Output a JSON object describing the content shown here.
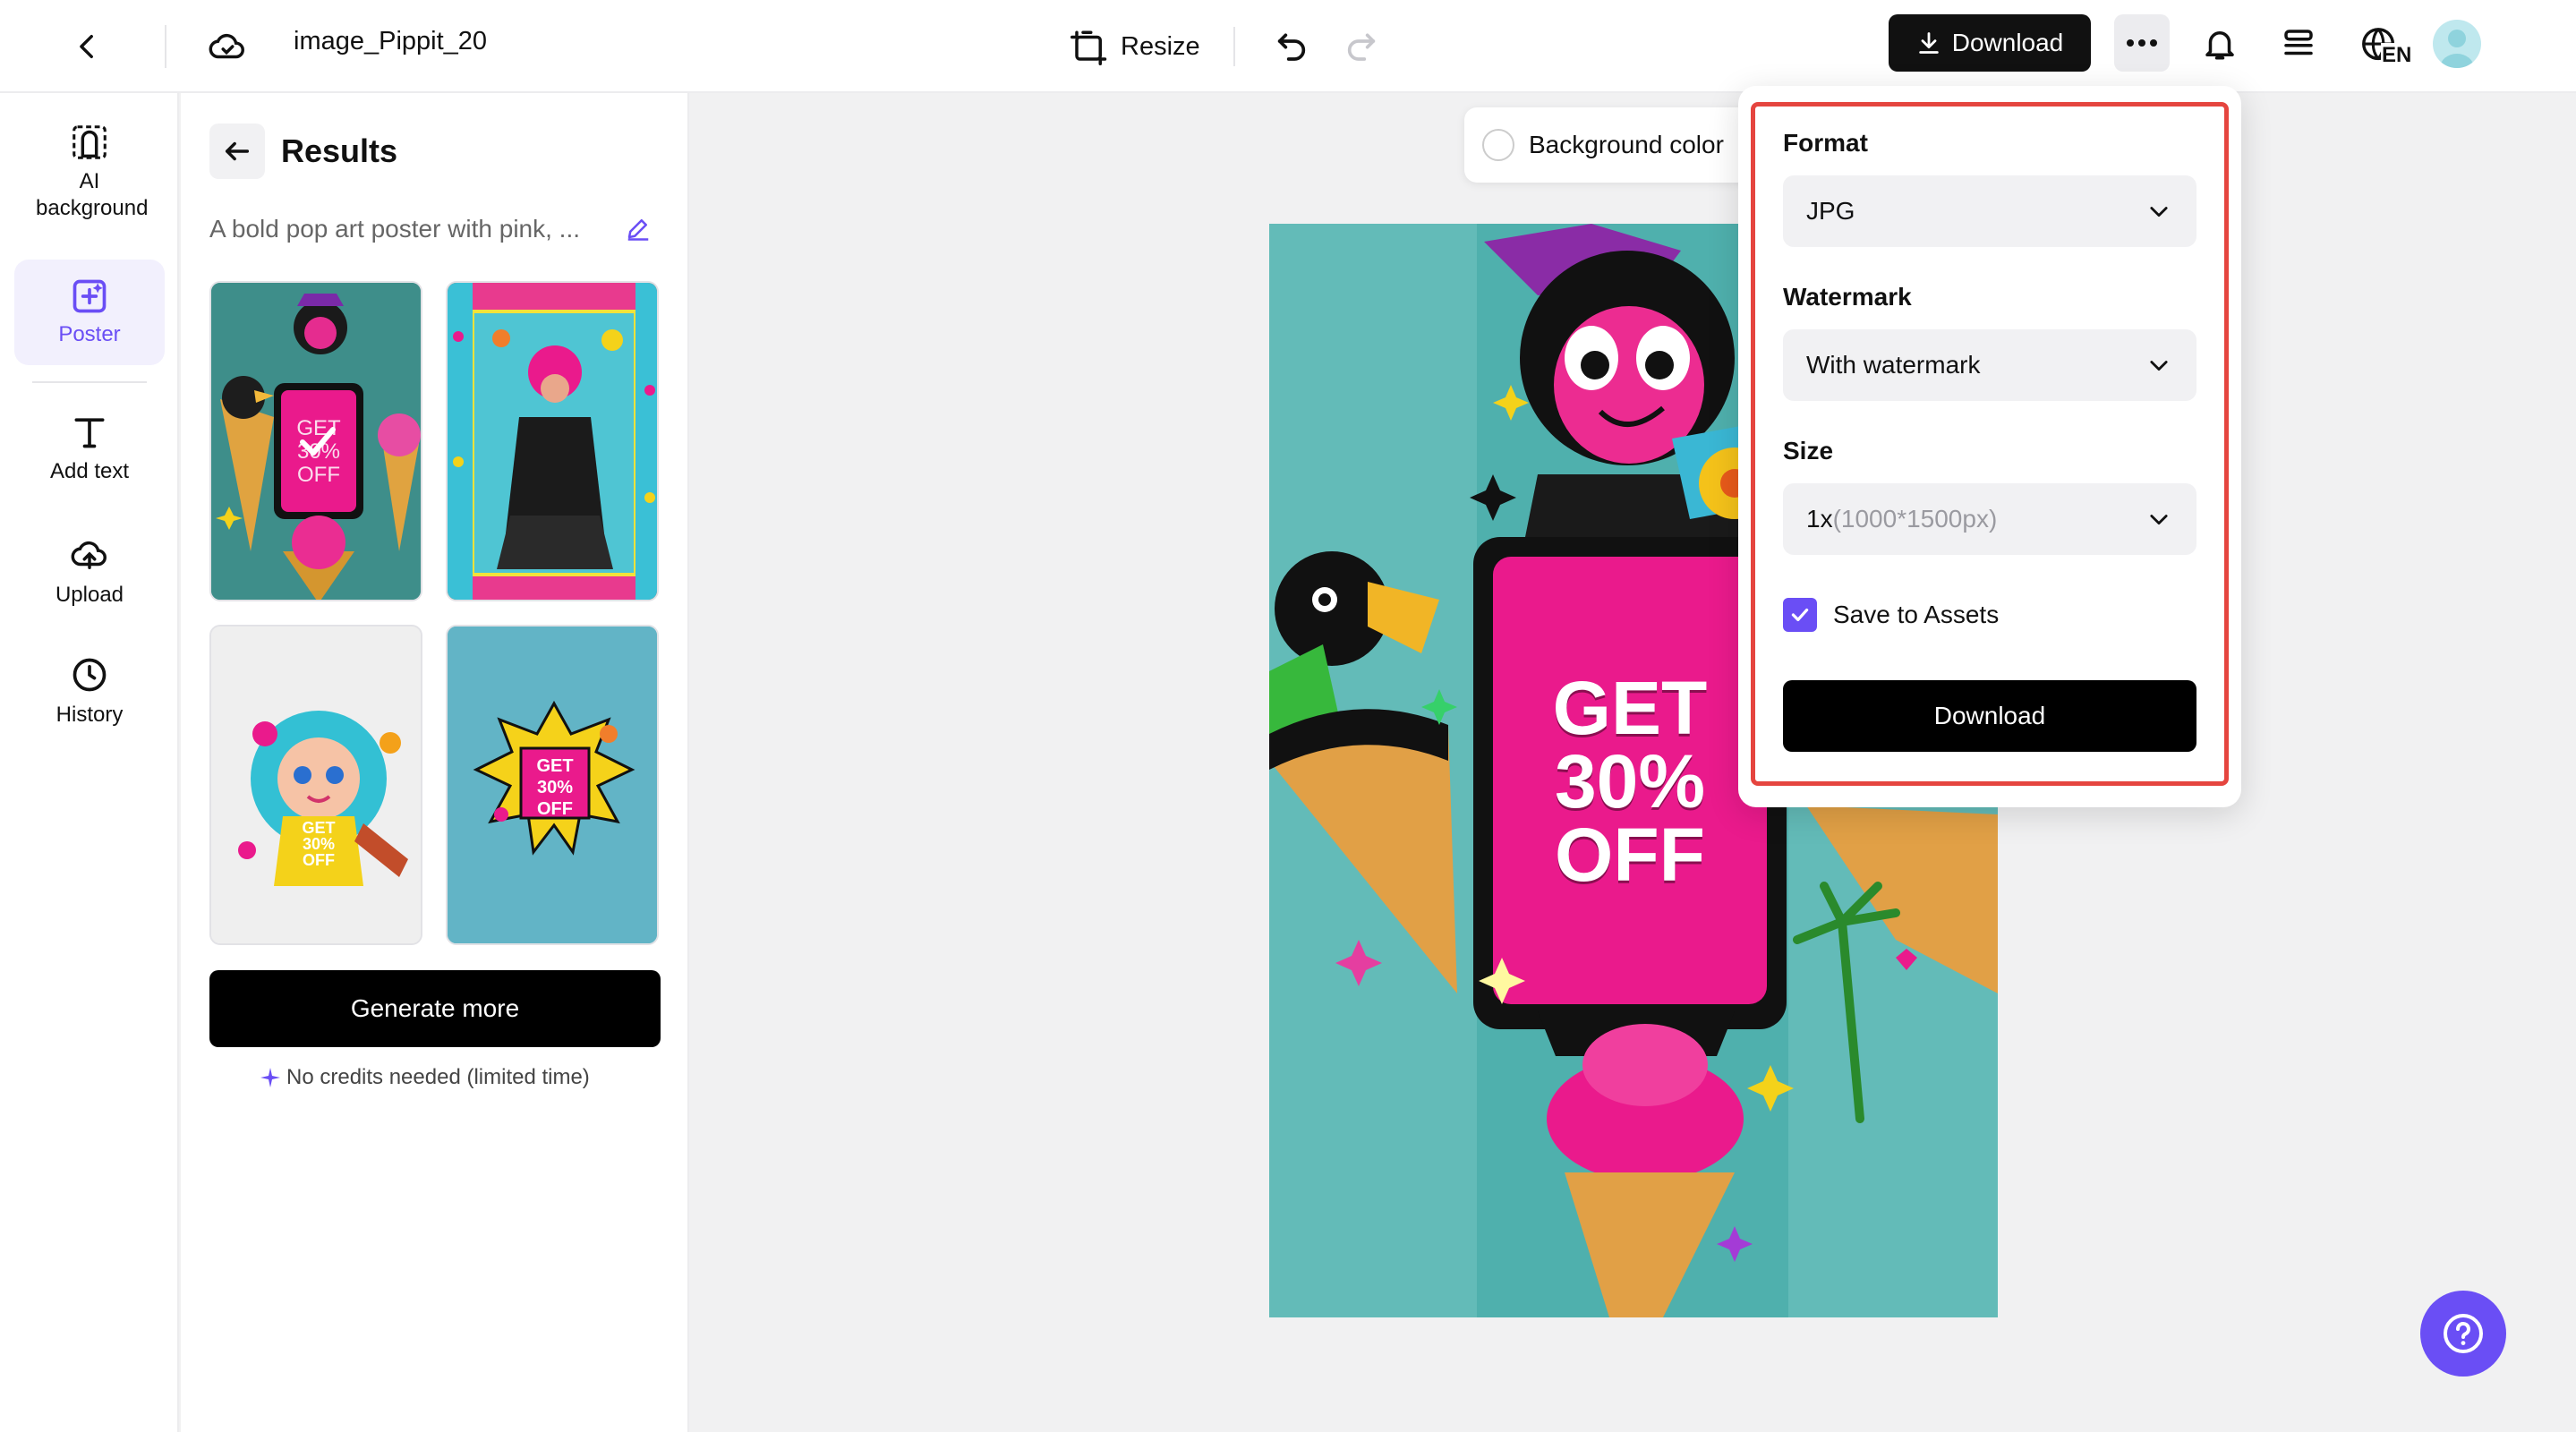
{
  "header": {
    "file_name": "image_Pippit_20",
    "resize_label": "Resize",
    "download_label": "Download",
    "lang": "EN"
  },
  "sidebar": {
    "items": [
      {
        "label": "AI background",
        "icon": "ai-background-icon"
      },
      {
        "label": "Poster",
        "icon": "poster-icon",
        "active": true
      },
      {
        "label": "Add text",
        "icon": "text-icon"
      },
      {
        "label": "Upload",
        "icon": "upload-icon"
      },
      {
        "label": "History",
        "icon": "history-icon"
      }
    ]
  },
  "results": {
    "title": "Results",
    "prompt": "A bold pop art poster with pink, ...",
    "thumb1_text": "GET 30% OFF",
    "thumb3_text": "GET 30% OFF",
    "thumb4_text": "GET 30% OFF",
    "generate_label": "Generate more",
    "credits_note": "No credits needed (limited time)"
  },
  "canvas": {
    "bg_color_label": "Background color",
    "poster_text_line1": "GET",
    "poster_text_line2": "30%",
    "poster_text_line3": "OFF"
  },
  "download_panel": {
    "format_label": "Format",
    "format_value": "JPG",
    "watermark_label": "Watermark",
    "watermark_value": "With watermark",
    "size_label": "Size",
    "size_value_main": "1x",
    "size_value_detail": "(1000*1500px)",
    "save_assets_label": "Save to Assets",
    "save_assets_checked": true,
    "download_button": "Download"
  },
  "colors": {
    "accent": "#6a4ef5",
    "highlight_border": "#e5453f",
    "teal": "#5fb8b5",
    "pink": "#ea1a8c"
  }
}
